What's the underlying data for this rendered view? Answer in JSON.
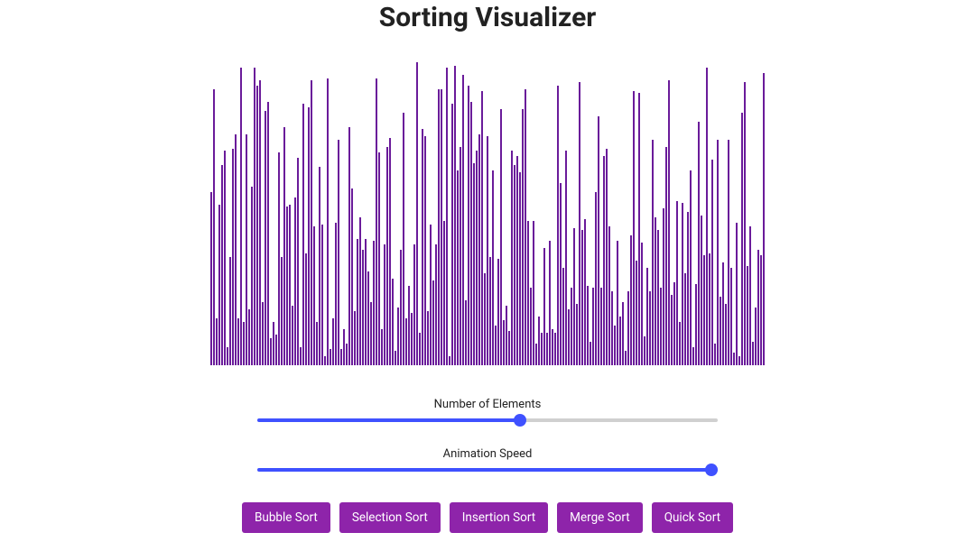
{
  "title": "Sorting Visualizer",
  "sliders": {
    "elements": {
      "label": "Number of Elements",
      "min": 10,
      "max": 350,
      "value": 205
    },
    "speed": {
      "label": "Animation Speed",
      "min": 1,
      "max": 100,
      "value": 100
    }
  },
  "buttons": {
    "bubble": "Bubble Sort",
    "selection": "Selection Sort",
    "insertion": "Insertion Sort",
    "merge": "Merge Sort",
    "quick": "Quick Sort"
  },
  "colors": {
    "bar": "#6a1b9a",
    "button": "#8e24aa",
    "slider": "#3f51ff"
  },
  "chart_data": {
    "type": "bar",
    "title": "Sorting Visualizer",
    "xlabel": "",
    "ylabel": "",
    "ylim": [
      0,
      340
    ],
    "categories": [],
    "values": [
      192,
      306,
      52,
      178,
      222,
      238,
      20,
      120,
      240,
      256,
      52,
      330,
      48,
      256,
      62,
      198,
      330,
      310,
      316,
      70,
      282,
      292,
      30,
      48,
      34,
      236,
      120,
      264,
      176,
      178,
      66,
      186,
      230,
      20,
      290,
      124,
      286,
      316,
      154,
      48,
      220,
      156,
      10,
      318,
      18,
      52,
      158,
      250,
      18,
      40,
      24,
      264,
      196,
      60,
      140,
      164,
      128,
      140,
      104,
      70,
      138,
      318,
      236,
      40,
      134,
      242,
      252,
      96,
      16,
      64,
      128,
      280,
      52,
      88,
      58,
      134,
      336,
      36,
      262,
      254,
      60,
      156,
      94,
      134,
      306,
      306,
      160,
      330,
      10,
      290,
      332,
      216,
      242,
      322,
      72,
      310,
      292,
      224,
      238,
      256,
      304,
      102,
      254,
      120,
      216,
      44,
      118,
      284,
      50,
      66,
      38,
      238,
      222,
      232,
      214,
      284,
      306,
      160,
      86,
      160,
      24,
      54,
      36,
      130,
      36,
      138,
      40,
      36,
      310,
      202,
      108,
      238,
      62,
      86,
      152,
      68,
      314,
      150,
      162,
      88,
      26,
      86,
      192,
      276,
      86,
      232,
      240,
      154,
      82,
      44,
      138,
      54,
      70,
      16,
      82,
      144,
      304,
      116,
      302,
      136,
      32,
      108,
      82,
      250,
      164,
      150,
      86,
      174,
      242,
      316,
      78,
      92,
      182,
      48,
      180,
      102,
      170,
      216,
      20,
      90,
      270,
      166,
      122,
      330,
      124,
      228,
      24,
      250,
      76,
      114,
      68,
      250,
      108,
      14,
      158,
      10,
      280,
      314,
      110,
      154,
      26,
      64,
      128,
      122,
      324
    ]
  }
}
